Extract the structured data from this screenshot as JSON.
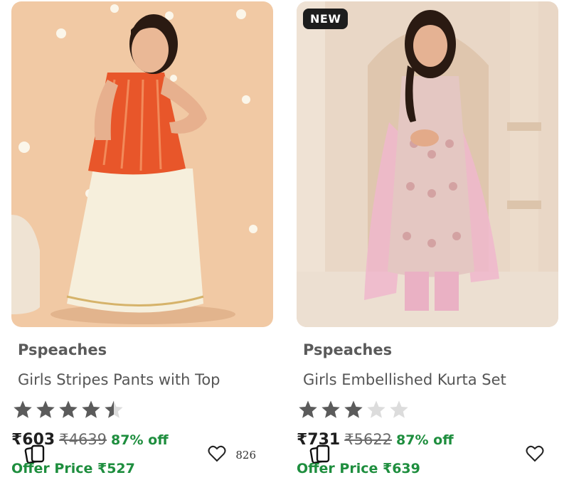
{
  "products": [
    {
      "brand": "Pspeaches",
      "title": "Girls Stripes Pants with Top",
      "rating": 4.5,
      "rating_max": 5,
      "price": "₹603",
      "mrp": "₹4639",
      "discount": "87% off",
      "offer_price": "Offer Price ₹527",
      "wishlist_count": "826",
      "image_icon": "girl-orange-top-white-skirt-photo"
    },
    {
      "badge": "NEW",
      "brand": "Pspeaches",
      "title": "Girls Embellished Kurta Set",
      "rating": 3,
      "rating_max": 5,
      "price": "₹731",
      "mrp": "₹5622",
      "discount": "87% off",
      "offer_price": "Offer Price ₹639",
      "image_icon": "girl-pink-kurta-set-photo"
    }
  ],
  "colors": {
    "star_filled": "#5b5b5b",
    "star_empty": "#dcdcdc",
    "discount_green": "#1e8e3e",
    "badge_bg": "#1d1d1d"
  },
  "icons": {
    "similar": "similar-cards-icon",
    "wishlist": "heart-outline-icon",
    "rating": "star-icon"
  }
}
